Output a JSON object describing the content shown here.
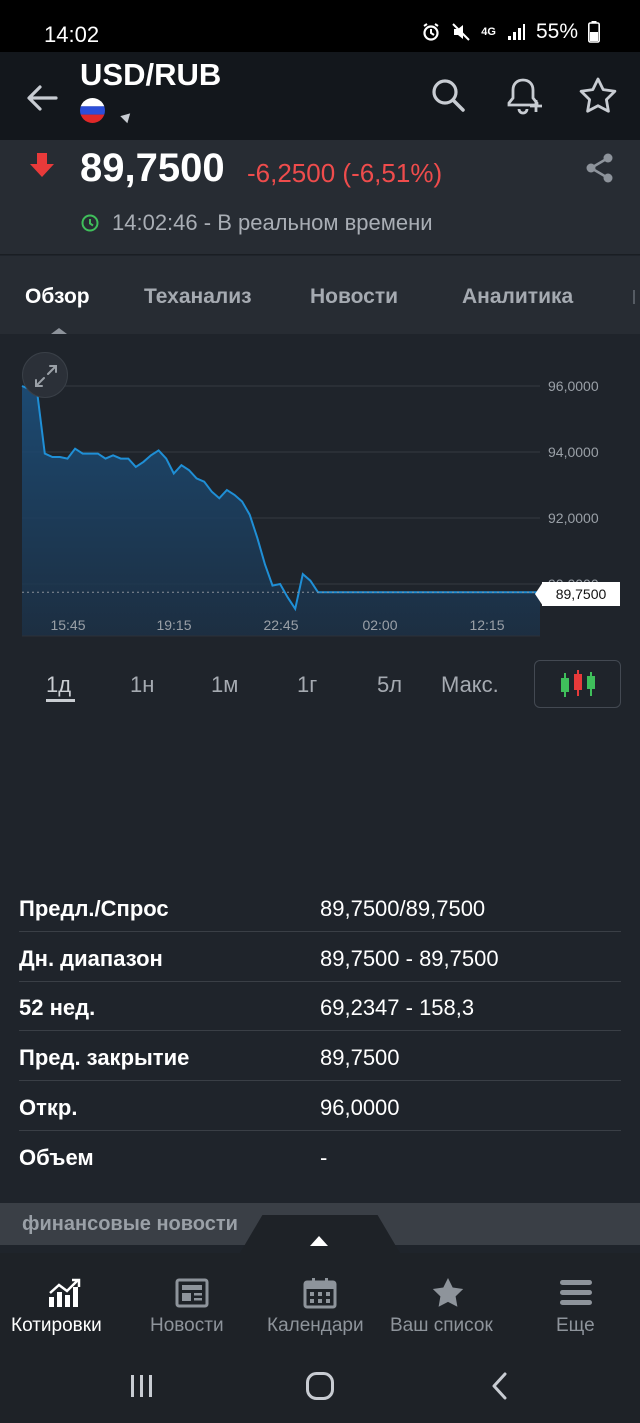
{
  "status_bar": {
    "time": "14:02",
    "battery": "55%",
    "network": "4G"
  },
  "header": {
    "title": "USD/RUB",
    "flag": "russia-flag"
  },
  "quote": {
    "price": "89,7500",
    "change": "-6,2500 (-6,51%)",
    "timestamp": "14:02:46 - В реальном времени",
    "direction": "down",
    "change_color": "#ef4c4c"
  },
  "tabs": [
    {
      "label": "Обзор",
      "active": true
    },
    {
      "label": "Теханализ",
      "active": false
    },
    {
      "label": "Новости",
      "active": false
    },
    {
      "label": "Аналитика",
      "active": false
    }
  ],
  "chart_data": {
    "type": "area",
    "x_ticks": [
      "15:45",
      "19:15",
      "22:45",
      "02:00",
      "12:15"
    ],
    "y_ticks": [
      "96,0000",
      "94,0000",
      "92,0000",
      "90,0000"
    ],
    "ylim": [
      88.5,
      96.5
    ],
    "current_value_label": "89,7500",
    "line_color": "#1f8fd6",
    "series": [
      {
        "values": [
          96.0,
          95.9,
          95.8,
          93.95,
          93.85,
          93.85,
          93.8,
          94.1,
          93.95,
          93.95,
          93.95,
          93.8,
          93.9,
          93.8,
          93.8,
          93.55,
          93.7,
          93.9,
          94.05,
          93.8,
          93.35,
          93.6,
          93.45,
          93.2,
          93.1,
          92.8,
          92.6,
          92.85,
          92.7,
          92.5,
          92.1,
          91.4,
          90.6,
          89.95,
          90.0,
          89.6,
          89.25,
          90.3,
          90.1,
          89.75,
          89.75,
          89.75,
          89.75,
          89.75,
          89.75,
          89.75,
          89.75,
          89.75
        ]
      }
    ]
  },
  "ranges": [
    {
      "label": "1д",
      "active": true
    },
    {
      "label": "1н",
      "active": false
    },
    {
      "label": "1м",
      "active": false
    },
    {
      "label": "1г",
      "active": false
    },
    {
      "label": "5л",
      "active": false
    },
    {
      "label": "Макс.",
      "active": false
    }
  ],
  "stats": [
    {
      "label": "Предл./Спрос",
      "value": "89,7500/89,7500"
    },
    {
      "label": "Дн. диапазон",
      "value": "89,7500 - 89,7500"
    },
    {
      "label": "52 нед.",
      "value": "69,2347 - 158,3"
    },
    {
      "label": "Пред. закрытие",
      "value": "89,7500"
    },
    {
      "label": "Откр.",
      "value": "96,0000"
    },
    {
      "label": "Объем",
      "value": "-"
    }
  ],
  "news_strip": {
    "title": "финансовые новости"
  },
  "bottom_nav": [
    {
      "label": "Котировки",
      "icon": "quotes-chart-icon",
      "active": true
    },
    {
      "label": "Новости",
      "icon": "news-icon",
      "active": false
    },
    {
      "label": "Календари",
      "icon": "calendar-icon",
      "active": false
    },
    {
      "label": "Ваш список",
      "icon": "star-icon",
      "active": false
    },
    {
      "label": "Еще",
      "icon": "menu-icon",
      "active": false
    }
  ]
}
